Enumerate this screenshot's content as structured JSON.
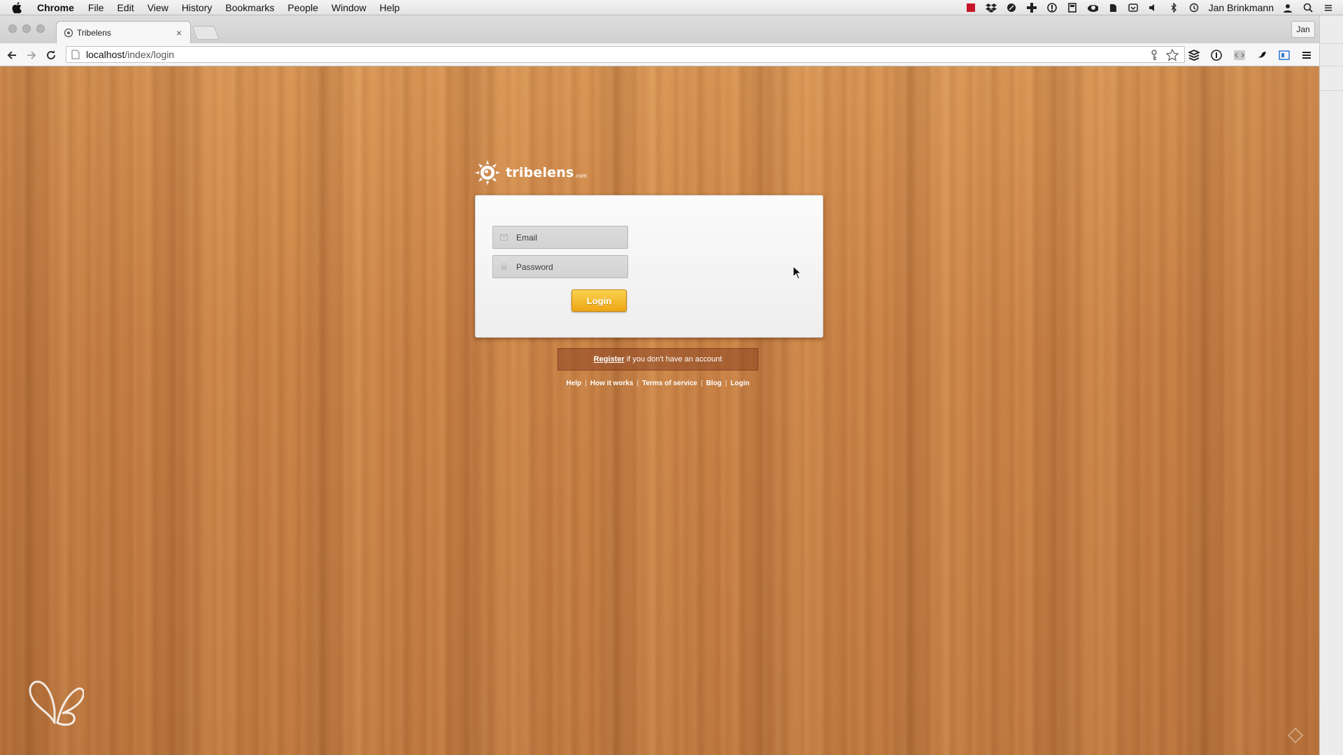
{
  "menubar": {
    "app_name": "Chrome",
    "items": [
      "File",
      "Edit",
      "View",
      "History",
      "Bookmarks",
      "People",
      "Window",
      "Help"
    ],
    "user": "Jan Brinkmann",
    "status_icons": [
      "red-app-icon",
      "dropbox-icon",
      "leaf-icon",
      "plus-icon",
      "info-icon",
      "book-icon",
      "cloud-icon",
      "evernote-icon",
      "shield-icon",
      "volume-icon",
      "bluetooth-icon",
      "time-machine-icon",
      "user-icon",
      "spotlight-icon",
      "notification-center-icon"
    ]
  },
  "browser": {
    "tab_title": "Tribelens",
    "tab_close": "×",
    "profile": "Jan",
    "url_host": "localhost",
    "url_path": "/index/login"
  },
  "page": {
    "logo_text": "tribelens",
    "logo_suffix": ".com",
    "email_placeholder": "Email",
    "password_placeholder": "Password",
    "login_label": "Login",
    "register_link": "Register",
    "register_text": "if you don't have an account",
    "footer_links": [
      "Help",
      "How it works",
      "Terms of service",
      "Blog",
      "Login"
    ],
    "footer_separator": "|"
  },
  "colors": {
    "wood_base": "#c98448",
    "login_button": "#f4b52a",
    "panel": "#f4f4f4"
  }
}
